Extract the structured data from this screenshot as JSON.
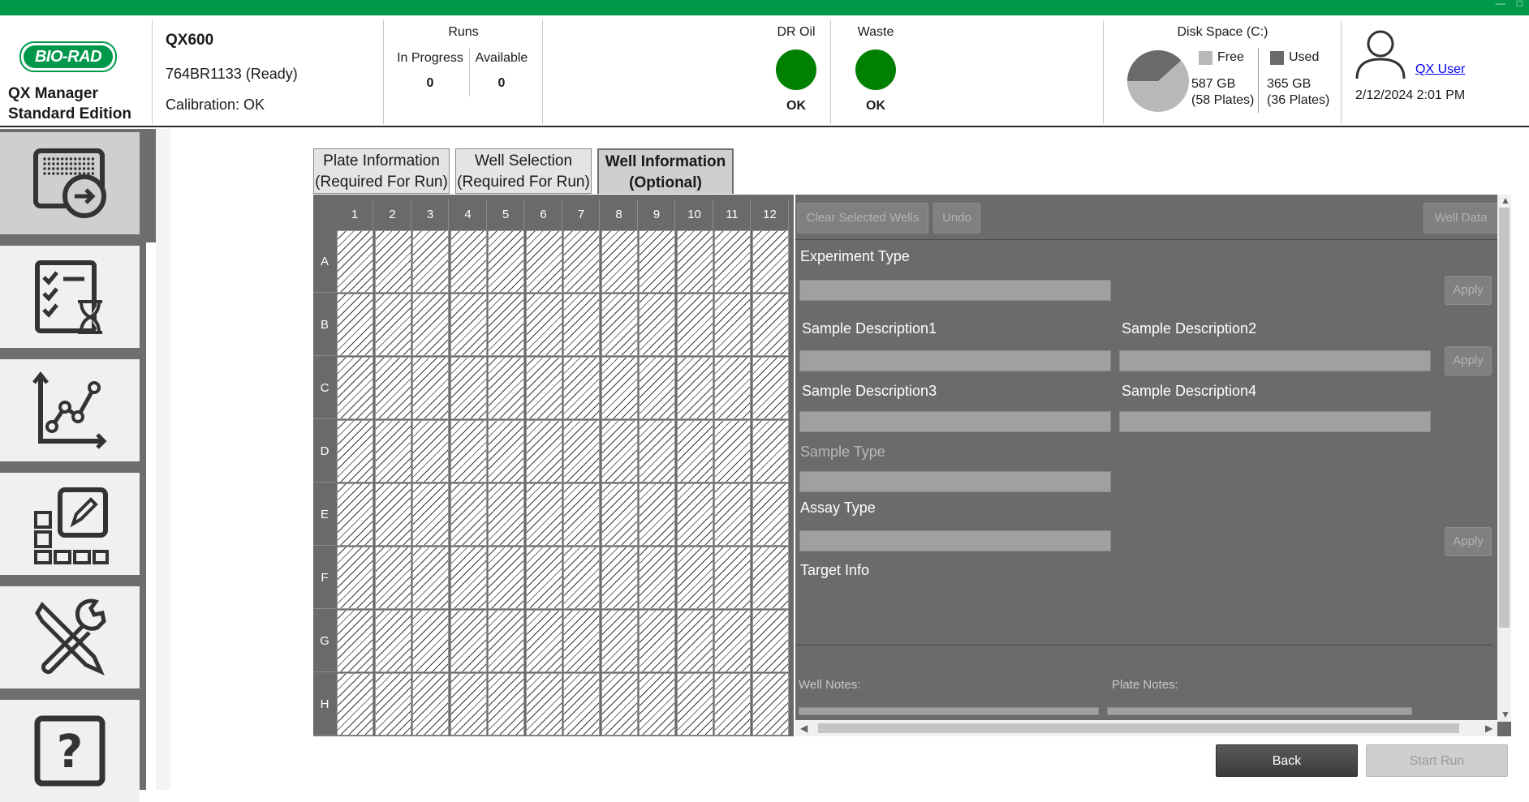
{
  "app": {
    "brand": "BIO-RAD",
    "name": "QX Manager Standard Edition"
  },
  "instrument": {
    "model": "QX600",
    "serial_status": "764BR1133 (Ready)",
    "calibration": "Calibration: OK"
  },
  "runs": {
    "title": "Runs",
    "in_progress_label": "In Progress",
    "in_progress_value": "0",
    "available_label": "Available",
    "available_value": "0"
  },
  "dr_oil": {
    "label": "DR Oil",
    "status": "OK",
    "color": "#008000"
  },
  "waste": {
    "label": "Waste",
    "status": "OK",
    "color": "#008000"
  },
  "disk": {
    "title": "Disk Space (C:)",
    "free_label": "Free",
    "free_size": "587 GB",
    "free_plates": "(58 Plates)",
    "used_label": "Used",
    "used_size": "365 GB",
    "used_plates": "(36 Plates)",
    "used_fraction": 0.383,
    "free_color": "#b8b8b8",
    "used_color": "#6a6a6a"
  },
  "user": {
    "name": "QX User",
    "datetime": "2/12/2024 2:01 PM"
  },
  "sidebar": {
    "items": [
      {
        "icon": "plate-run-icon",
        "active": true
      },
      {
        "icon": "checklist-hourglass-icon",
        "active": false
      },
      {
        "icon": "data-analysis-icon",
        "active": false
      },
      {
        "icon": "plate-editor-icon",
        "active": false
      },
      {
        "icon": "tools-icon",
        "active": false
      },
      {
        "icon": "help-icon",
        "active": false
      }
    ]
  },
  "tabs": [
    {
      "line1": "Plate Information",
      "line2": "(Required For Run)",
      "active": false
    },
    {
      "line1": "Well Selection",
      "line2": "(Required For Run)",
      "active": false
    },
    {
      "line1": "Well Information",
      "line2": "(Optional)",
      "active": true
    }
  ],
  "plate": {
    "columns": [
      "1",
      "2",
      "3",
      "4",
      "5",
      "6",
      "7",
      "8",
      "9",
      "10",
      "11",
      "12"
    ],
    "rows": [
      "A",
      "B",
      "C",
      "D",
      "E",
      "F",
      "G",
      "H"
    ]
  },
  "panel": {
    "clear_selected_label": "Clear Selected Wells",
    "undo_label": "Undo",
    "well_data_label": "Well Data",
    "experiment_type_label": "Experiment Type",
    "sample_desc1_label": "Sample Description1",
    "sample_desc2_label": "Sample Description2",
    "sample_desc3_label": "Sample Description3",
    "sample_desc4_label": "Sample Description4",
    "sample_type_label": "Sample Type",
    "assay_type_label": "Assay Type",
    "target_info_label": "Target Info",
    "apply_label": "Apply",
    "well_notes_label": "Well Notes:",
    "plate_notes_label": "Plate Notes:"
  },
  "footer": {
    "back_label": "Back",
    "start_run_label": "Start Run"
  }
}
